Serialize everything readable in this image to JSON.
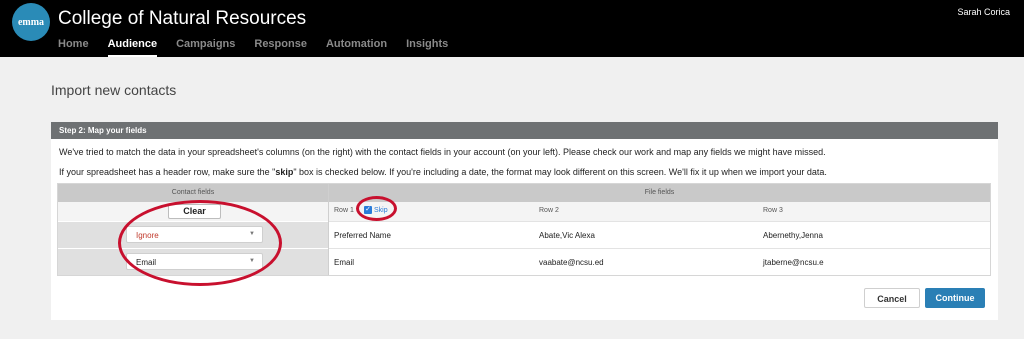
{
  "header": {
    "logo_text": "emma",
    "app_title": "College of Natural Resources",
    "user_name": "Sarah Corica",
    "nav": [
      {
        "label": "Home"
      },
      {
        "label": "Audience"
      },
      {
        "label": "Campaigns"
      },
      {
        "label": "Response"
      },
      {
        "label": "Automation"
      },
      {
        "label": "Insights"
      }
    ],
    "active_nav": "Audience"
  },
  "page": {
    "title": "Import new contacts"
  },
  "step": {
    "header": "Step 2: Map your fields",
    "intro_1": "We've tried to match the data in your spreadsheet's columns (on the right) with the contact fields in your account (on your left). Please check our work and map any fields we might have missed.",
    "intro_2_before": "If your spreadsheet has a header row, make sure the \"",
    "intro_2_bold": "skip",
    "intro_2_after": "\" box is checked below. If you're including a date, the format may look different on this screen. We'll fix it up when we import your data."
  },
  "mapping": {
    "contact_fields_header": "Contact fields",
    "file_fields_header": "File fields",
    "clear_label": "Clear",
    "row_labels": [
      "Row 1",
      "Row 2",
      "Row 3"
    ],
    "skip_label": "Skip",
    "skip_checked": true,
    "rows": [
      {
        "field": "Ignore",
        "values": [
          "Preferred Name",
          "Abate,Vic Alexa",
          "Abernethy,Jenna"
        ]
      },
      {
        "field": "Email",
        "values": [
          "Email",
          "vaabate@ncsu.ed",
          "jtaberne@ncsu.e"
        ]
      }
    ]
  },
  "actions": {
    "cancel": "Cancel",
    "continue": "Continue"
  },
  "colors": {
    "accent": "#2a7fb5",
    "annotation": "#c8102e",
    "ignore_text": "#c0392b"
  }
}
